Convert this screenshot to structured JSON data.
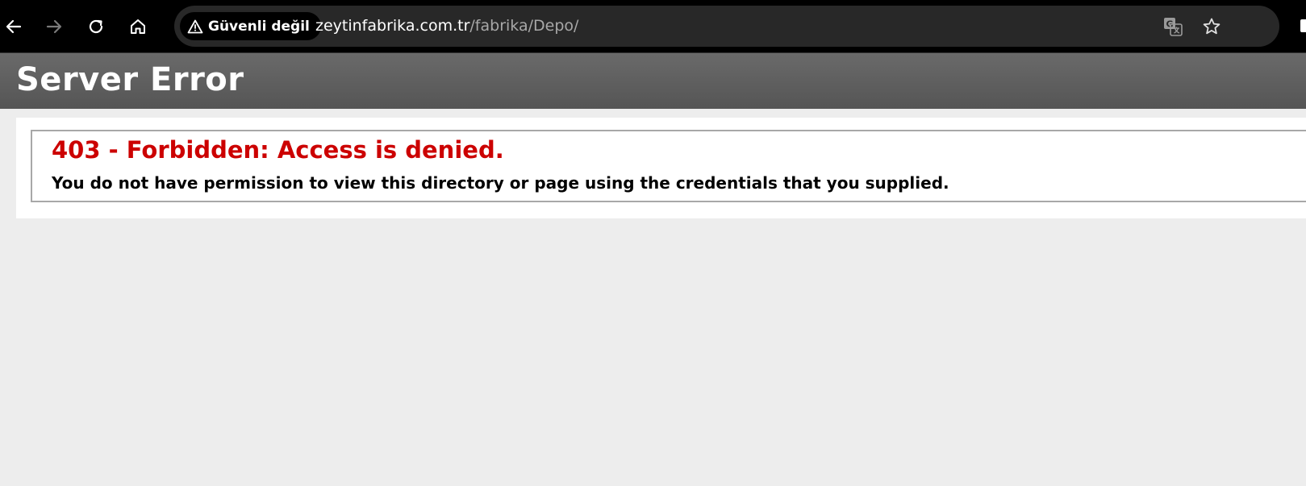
{
  "browser": {
    "security_label": "Güvenli değil",
    "url_host": "zeytinfabrika.com.tr",
    "url_path": "/fabrika/Depo/",
    "icons": {
      "back": "back-arrow-icon",
      "forward": "forward-arrow-icon",
      "reload": "reload-icon",
      "home": "home-icon",
      "warning": "warning-icon",
      "translate": "translate-icon",
      "bookmark": "star-icon"
    }
  },
  "page": {
    "header_title": "Server Error",
    "error_heading": "403 - Forbidden: Access is denied.",
    "error_message": "You do not have permission to view this directory or page using the credentials that you supplied."
  },
  "colors": {
    "toolbar_bg": "#000000",
    "omnibox_bg": "#282828",
    "header_bg": "#5e5e5e",
    "error_red": "#cc0000",
    "page_bg": "#ededed"
  }
}
